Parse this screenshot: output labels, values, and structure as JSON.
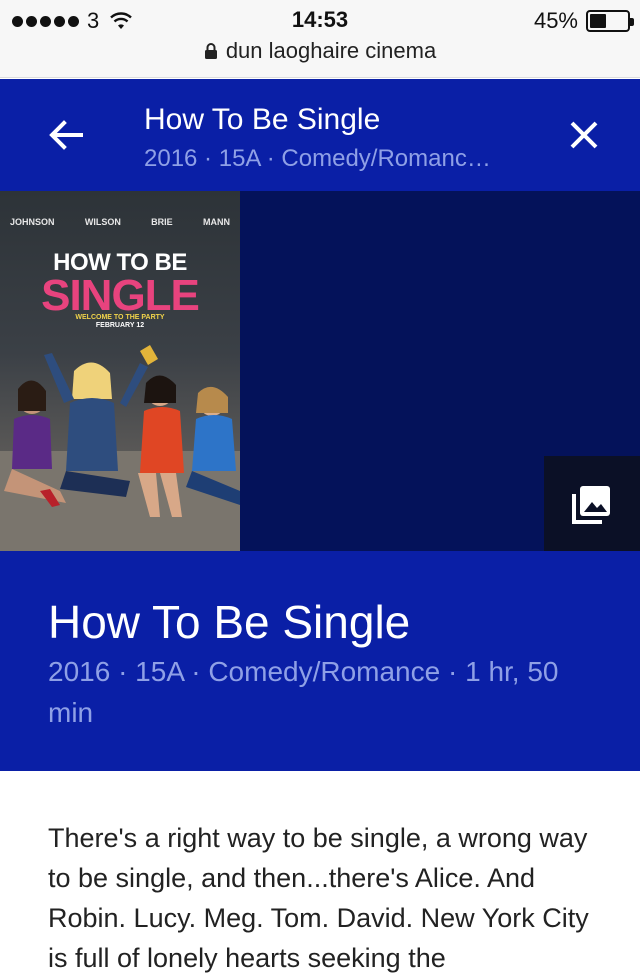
{
  "status_bar": {
    "carrier": "3",
    "time": "14:53",
    "battery_percent": "45%",
    "battery_level": 0.45,
    "signal_bars": 5,
    "url": "dun laoghaire cinema"
  },
  "header": {
    "title": "How To Be Single",
    "subtitle": "2016 · 15A · Comedy/Romanc…",
    "back_icon": "arrow-left-icon",
    "close_icon": "close-icon"
  },
  "poster": {
    "cast": [
      "JOHNSON",
      "WILSON",
      "BRIE",
      "MANN"
    ],
    "title_line_1": "HOW TO BE",
    "title_line_2": "SINGLE",
    "tagline": "WELCOME TO THE PARTY",
    "release": "FEBRUARY 12"
  },
  "gallery_icon": "photo-gallery-icon",
  "movie": {
    "title": "How To Be Single",
    "meta": "2016 · 15A · Comedy/Romance · 1 hr, 50 min",
    "description": "There's a right way to be single, a wrong way to be single, and then...there's Alice. And Robin. Lucy. Meg. Tom. David. New York City is full of lonely hearts seeking the"
  },
  "colors": {
    "header_blue": "#0a1fa6",
    "strip_navy": "#04125a",
    "subtitle_blue": "#8fa0e6",
    "poster_pink": "#e8437e"
  }
}
